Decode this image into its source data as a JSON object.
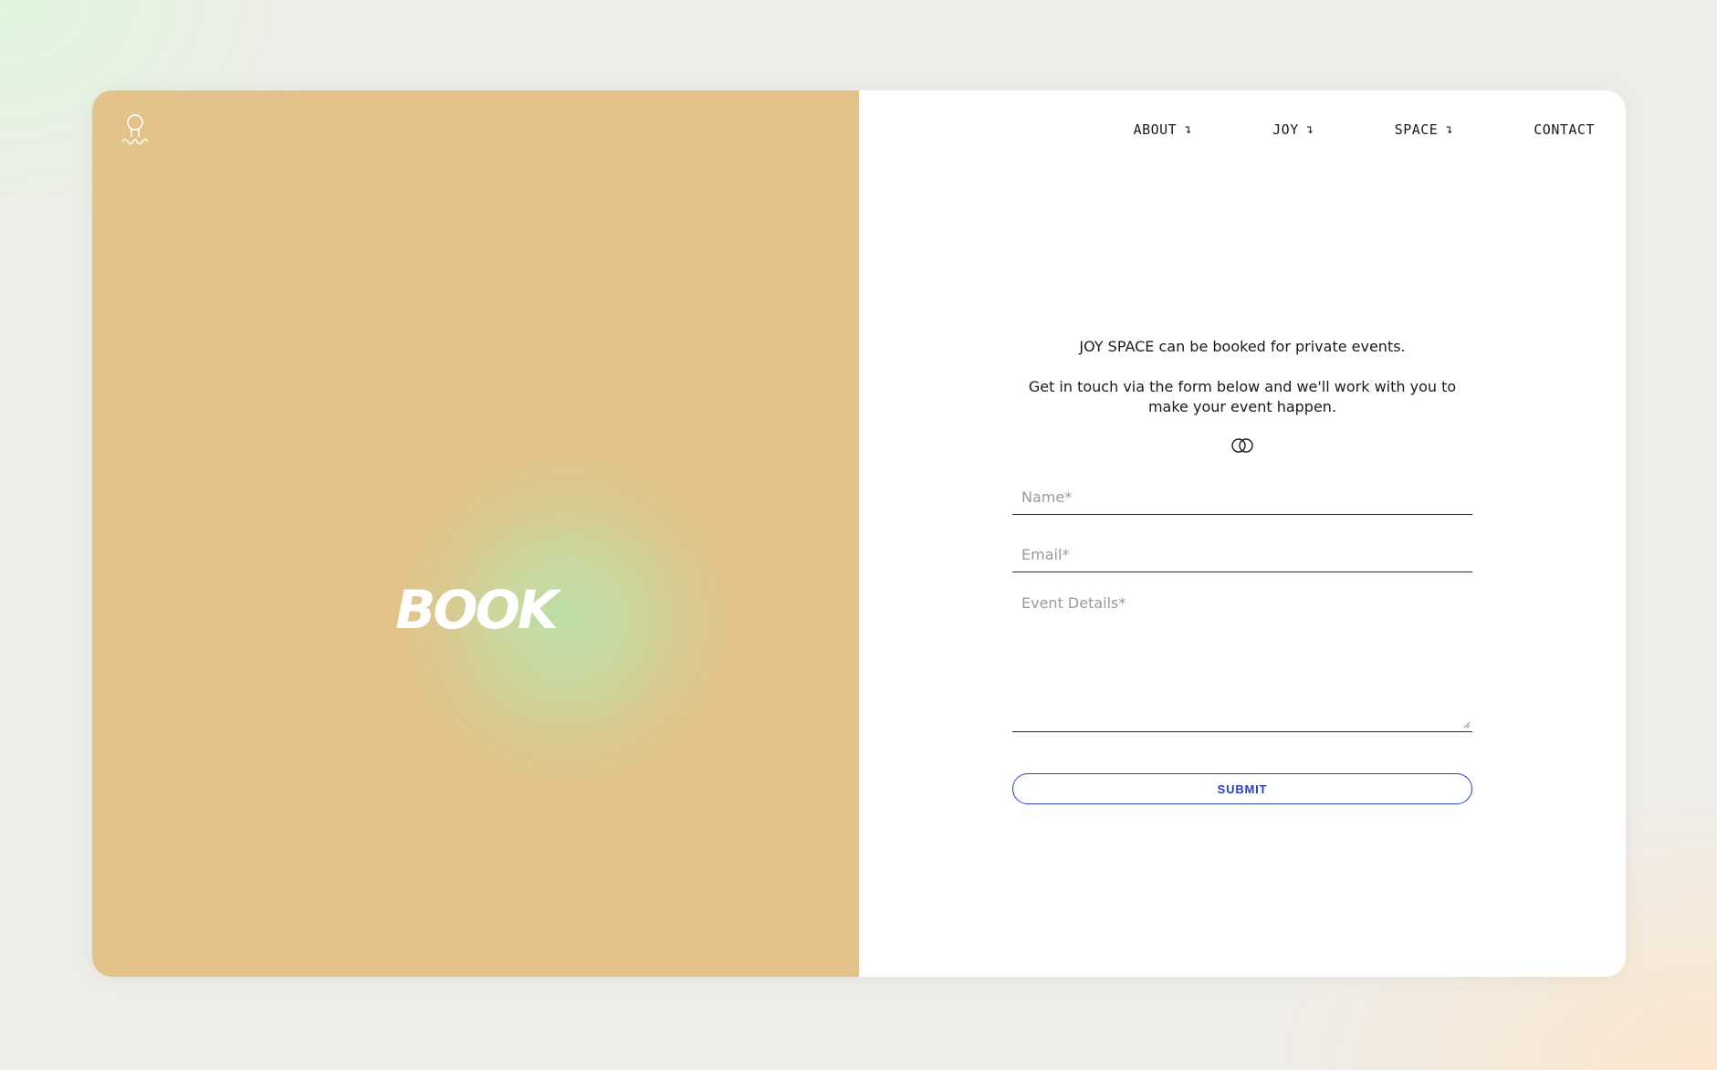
{
  "left": {
    "hero_word": "BOOK"
  },
  "nav": {
    "about": "ABOUT",
    "joy": "JOY",
    "space": "SPACE",
    "contact": "CONTACT",
    "arrow": "↴"
  },
  "intro": {
    "line1": "JOY SPACE can be booked for private events.",
    "line2": "Get in touch via the form below and we'll work with you to make your event happen."
  },
  "form": {
    "name_placeholder": "Name*",
    "email_placeholder": "Email*",
    "details_placeholder": "Event Details*",
    "submit_label": "SUBMIT"
  },
  "colors": {
    "left_panel": "#e3c389",
    "accent_blue": "#2a3fc0",
    "glow_green": "#bcdea6"
  },
  "icons": {
    "logo": "joy-space-logo-icon",
    "divider": "interlocking-rings-icon"
  }
}
